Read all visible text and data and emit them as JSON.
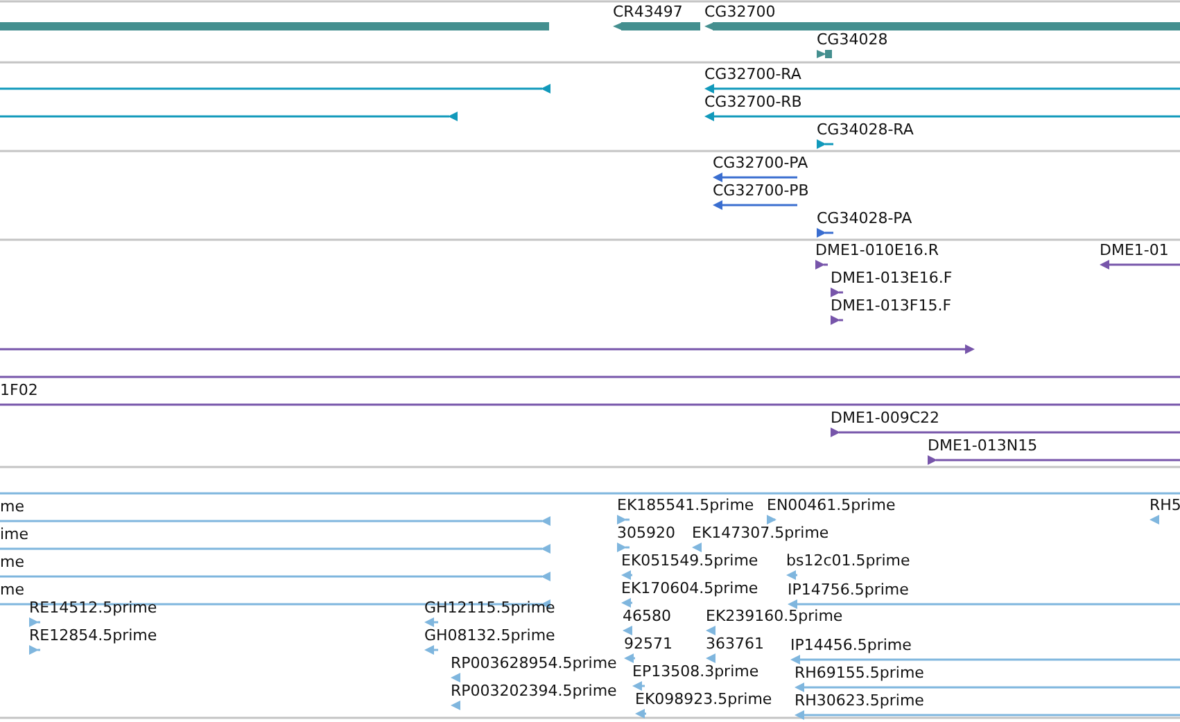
{
  "tracks": [
    {
      "kind": "gene",
      "features": [
        {
          "kind": "plain"
        },
        {
          "kind": "arrow",
          "label": "CR43497",
          "reverse": true
        },
        {
          "kind": "arrow",
          "label": "CG32700",
          "reverse": true
        },
        {
          "kind": "arrow",
          "label": "CG34028",
          "reverse": false
        }
      ]
    },
    {
      "kind": "transcript",
      "features": [
        {
          "kind": "arrow",
          "reverse": true
        },
        {
          "kind": "arrow",
          "reverse": true
        },
        {
          "kind": "arrow",
          "label": "CG32700-RA",
          "reverse": true
        },
        {
          "kind": "arrow",
          "label": "CG32700-RB",
          "reverse": true
        },
        {
          "kind": "arrow",
          "label": "CG34028-RA",
          "reverse": false
        }
      ]
    },
    {
      "kind": "protein",
      "features": [
        {
          "kind": "arrow",
          "label": "CG32700-PA",
          "reverse": true
        },
        {
          "kind": "arrow",
          "label": "CG32700-PB",
          "reverse": true
        },
        {
          "kind": "arrow",
          "label": "CG34028-PA",
          "reverse": false
        }
      ]
    },
    {
      "kind": "clone",
      "features": [
        {
          "kind": "arrow",
          "label": "DME1-010E16.R",
          "reverse": false
        },
        {
          "kind": "arrow",
          "label": "DME1-01",
          "reverse": true
        },
        {
          "kind": "arrow",
          "label": "DME1-013E16.F",
          "reverse": false
        },
        {
          "kind": "arrow",
          "label": "DME1-013F15.F",
          "reverse": false
        },
        {
          "kind": "arrow",
          "reverse": false
        },
        {
          "kind": "plain"
        },
        {
          "kind": "plain",
          "label": "1F02"
        },
        {
          "kind": "arrow",
          "label": "DME1-009C22",
          "reverse": false
        },
        {
          "kind": "arrow",
          "label": "DME1-013N15",
          "reverse": false
        }
      ]
    },
    {
      "kind": "est",
      "features": [
        {
          "kind": "plain"
        },
        {
          "kind": "arrow",
          "label": "me",
          "reverse": true
        },
        {
          "kind": "arrow",
          "label": "ime",
          "reverse": true
        },
        {
          "kind": "arrow",
          "label": "me",
          "reverse": true
        },
        {
          "kind": "arrow",
          "label": "me",
          "reverse": true
        },
        {
          "kind": "arrow",
          "label": "RE14512.5prime",
          "reverse": false
        },
        {
          "kind": "arrow",
          "label": "RE12854.5prime",
          "reverse": false
        },
        {
          "kind": "arrow",
          "label": "GH12115.5prime",
          "reverse": true
        },
        {
          "kind": "arrow",
          "label": "GH08132.5prime",
          "reverse": true
        },
        {
          "kind": "arrow",
          "label": "RP003628954.5prime",
          "reverse": true
        },
        {
          "kind": "arrow",
          "label": "RP003202394.5prime",
          "reverse": true
        },
        {
          "kind": "arrow",
          "label": "EK185541.5prime",
          "reverse": false
        },
        {
          "kind": "arrow",
          "label": "EN00461.5prime",
          "reverse": false
        },
        {
          "kind": "arrow",
          "label": "RH5",
          "reverse": true
        },
        {
          "kind": "arrow",
          "label": "305920",
          "reverse": false
        },
        {
          "kind": "arrow",
          "label": "EK147307.5prime",
          "reverse": true
        },
        {
          "kind": "arrow",
          "label": "EK051549.5prime",
          "reverse": true
        },
        {
          "kind": "arrow",
          "label": "bs12c01.5prime",
          "reverse": true
        },
        {
          "kind": "arrow",
          "label": "EK170604.5prime",
          "reverse": true
        },
        {
          "kind": "arrow",
          "label": "IP14756.5prime",
          "reverse": true
        },
        {
          "kind": "arrow",
          "label": "46580",
          "reverse": true
        },
        {
          "kind": "arrow",
          "label": "EK239160.5prime",
          "reverse": true
        },
        {
          "kind": "arrow",
          "label": "92571",
          "reverse": true
        },
        {
          "kind": "arrow",
          "label": "363761",
          "reverse": true
        },
        {
          "kind": "arrow",
          "label": "IP14456.5prime",
          "reverse": true
        },
        {
          "kind": "arrow",
          "label": "EP13508.3prime",
          "reverse": true
        },
        {
          "kind": "arrow",
          "label": "RH69155.5prime",
          "reverse": true
        },
        {
          "kind": "arrow",
          "label": "EK098923.5prime",
          "reverse": true
        },
        {
          "kind": "arrow",
          "label": "RH30623.5prime",
          "reverse": true
        }
      ]
    }
  ]
}
